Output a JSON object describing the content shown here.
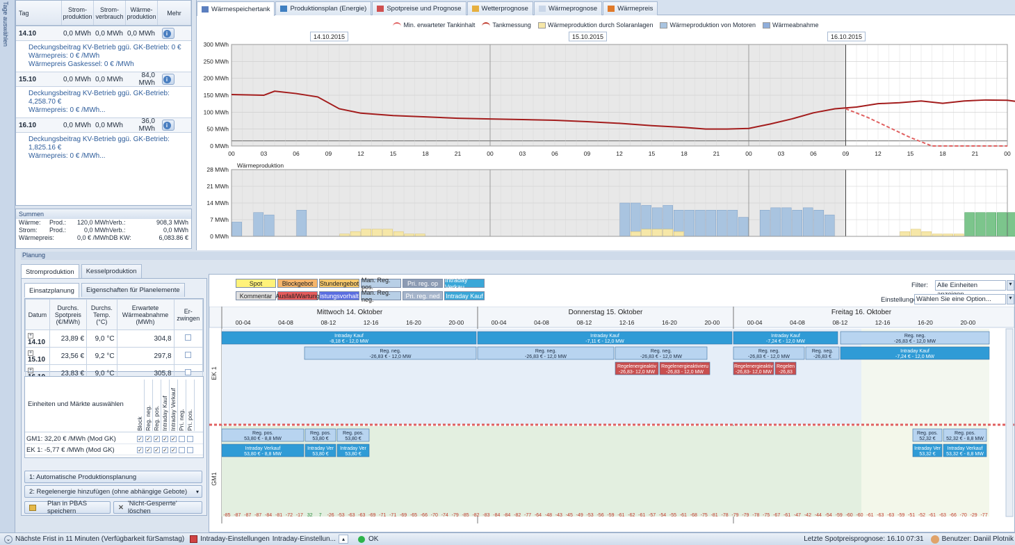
{
  "sidebar": {
    "vertical_label": "Tage auswählen"
  },
  "day_table": {
    "headers": [
      "Tag",
      "Strom-produktion",
      "Strom-verbrauch",
      "Wärme-produktion",
      "Mehr"
    ],
    "days": [
      {
        "date": "14.10",
        "strom_prod": "0,0 MWh",
        "strom_verb": "0,0 MWh",
        "waerme": "0,0 MWh",
        "lines": [
          "Deckungsbeitrag KV-Betrieb ggü. GK-Betrieb: 0 €",
          "Wärmepreis: 0 € /MWh",
          "Wärmepreis Gaskessel: 0 € /MWh"
        ]
      },
      {
        "date": "15.10",
        "strom_prod": "0,0 MWh",
        "strom_verb": "0,0 MWh",
        "waerme": "84,0 MWh",
        "lines": [
          "Deckungsbeitrag KV-Betrieb ggü. GK-Betrieb:",
          "4,258.70 €",
          "Wärmepreis: 0 € /MWh..."
        ]
      },
      {
        "date": "16.10",
        "strom_prod": "0,0 MWh",
        "strom_verb": "0,0 MWh",
        "waerme": "36,0 MWh",
        "lines": [
          "Deckungsbeitrag KV-Betrieb ggü. GK-Betrieb:",
          "1,825.16 €",
          "Wärmepreis: 0 € /MWh..."
        ]
      }
    ]
  },
  "summen": {
    "title": "Summen",
    "rows": [
      [
        "Wärme:",
        "Prod.:",
        "120,0 MWh",
        "Verb.:",
        "908,3 MWh"
      ],
      [
        "Strom:",
        "Prod.:",
        "0,0 MWh",
        "Verb.:",
        "0,0 MWh"
      ],
      [
        "Wärmepreis:",
        "",
        "0,0 € /MWh",
        "DB KW:",
        "6,083.86 €"
      ]
    ]
  },
  "chart_tabs": [
    "Wärmespeichertank",
    "Produktionsplan (Energie)",
    "Spotpreise und Prognose",
    "Wetterprognose",
    "Wärmeprognose",
    "Wärmepreis"
  ],
  "chart_legend": [
    {
      "label": "Min. erwarteter Tankinhalt",
      "color": "#e06060"
    },
    {
      "label": "Tankmessung",
      "color": "#c0392b"
    },
    {
      "label": "Wärmeproduktion durch Solaranlagen",
      "color": "#f6e7a8"
    },
    {
      "label": "Wärmeproduktion von Motoren",
      "color": "#a9c4e0"
    },
    {
      "label": "Wärmeabnahme",
      "color": "#8faedb"
    }
  ],
  "chart_dates": [
    "14.10.2015",
    "15.10.2015",
    "16.10.2015"
  ],
  "chart_data": [
    {
      "type": "line",
      "title": "",
      "ylabel": "",
      "xlabel": "",
      "ylim": [
        0,
        300
      ],
      "yticks": [
        "0 MWh",
        "50 MWh",
        "100 MWh",
        "150 MWh",
        "200 MWh",
        "250 MWh",
        "300 MWh"
      ],
      "xticks": [
        "00",
        "03",
        "06",
        "09",
        "12",
        "15",
        "18",
        "21",
        "00",
        "03",
        "06",
        "09",
        "12",
        "15",
        "18",
        "21",
        "00",
        "03",
        "06",
        "09",
        "12",
        "15",
        "18",
        "21",
        "00"
      ],
      "x_hours": [
        0,
        3,
        4,
        6,
        8,
        10,
        12,
        15,
        18,
        21,
        24,
        27,
        30,
        33,
        36,
        39,
        42,
        44,
        46,
        48,
        50,
        52,
        54,
        56,
        58,
        60,
        62,
        64,
        66,
        68,
        70,
        72,
        75,
        78,
        81,
        84,
        87,
        90
      ],
      "series": [
        {
          "name": "Tankmessung",
          "values": [
            152,
            150,
            162,
            155,
            145,
            110,
            97,
            90,
            86,
            82,
            80,
            78,
            76,
            72,
            67,
            60,
            55,
            50,
            50,
            52,
            65,
            80,
            98,
            110,
            115,
            125,
            128,
            133,
            126,
            133,
            136,
            135,
            123,
            110
          ],
          "x": [
            0,
            3,
            4,
            6,
            8,
            10,
            12,
            15,
            18,
            21,
            24,
            27,
            30,
            33,
            36,
            39,
            42,
            44,
            46,
            48,
            50,
            52,
            54,
            56,
            58,
            60,
            62,
            64,
            66,
            68,
            70,
            72,
            75,
            78
          ]
        },
        {
          "name": "Min. erwarteter Tankinhalt",
          "values": [
            110,
            85,
            55,
            25,
            0,
            0,
            0
          ],
          "x": [
            57,
            59,
            61,
            63,
            65,
            67,
            72
          ],
          "forecast": true
        }
      ],
      "forecast_start_hour": 57
    },
    {
      "type": "bar",
      "title": "Wärmeproduktion",
      "ylim": [
        0,
        28
      ],
      "yticks": [
        "0 MWh",
        "7 MWh",
        "14 MWh",
        "21 MWh",
        "28 MWh"
      ],
      "series": [
        {
          "name": "Wärmeproduktion von Motoren",
          "hours": [
            0,
            2,
            3,
            5,
            6,
            35,
            36,
            37,
            38,
            39,
            40,
            41,
            42,
            43,
            44,
            45,
            46,
            47,
            48,
            49,
            50,
            51,
            52,
            53,
            54,
            55,
            56,
            57
          ],
          "values": [
            6,
            10,
            9,
            0,
            11,
            0,
            14,
            14,
            13,
            12,
            13,
            11,
            11,
            11,
            11,
            11,
            11,
            8,
            0,
            11,
            12,
            12,
            11,
            12,
            11,
            9,
            0,
            0
          ]
        },
        {
          "name": "Wärmeproduktion durch Solaranlagen",
          "hours": [
            10,
            11,
            12,
            13,
            14,
            15,
            16,
            17,
            37,
            38,
            39,
            40,
            41,
            62,
            63,
            64,
            65,
            66,
            67
          ],
          "values": [
            1,
            2,
            3,
            3,
            3,
            2,
            1,
            1,
            2,
            3,
            3,
            3,
            2,
            2,
            3,
            2,
            1,
            1,
            1
          ]
        },
        {
          "name": "Wärmeabnahme",
          "hours": [
            68,
            69,
            70,
            71,
            72
          ],
          "values": [
            10,
            10,
            10,
            10,
            10
          ]
        }
      ]
    }
  ],
  "planung": {
    "title": "Planung",
    "tabs": [
      "Stromproduktion",
      "Kesselproduktion"
    ],
    "subtabs": [
      "Einsatzplanung",
      "Eigenschaften für Planelemente"
    ],
    "grid_headers": [
      "Datum",
      "Durchs. Spotpreis (€/MWh)",
      "Durchs. Temp. (°C)",
      "Erwartete Wärmeabnahme (MWh)",
      "Er-zwingen"
    ],
    "grid_rows": [
      [
        "14.10",
        "23,89 €",
        "9,0 °C",
        "304,8"
      ],
      [
        "15.10",
        "23,56 €",
        "9,2 °C",
        "297,8"
      ],
      [
        "16.10",
        "23,83 €",
        "9,0 °C",
        "305,8"
      ]
    ],
    "units_title": "Einheiten und Märkte auswählen",
    "units_cols": [
      "Block",
      "Reg. neg.",
      "Reg. pos.",
      "Intraday Kauf",
      "Intraday Verkauf",
      "Pri. neg.",
      "Pri. pos."
    ],
    "units": [
      {
        "label": "GM1: 32,20 € /MWh (Mod GK)",
        "checks": [
          true,
          true,
          true,
          true,
          true,
          false,
          false
        ]
      },
      {
        "label": "EK 1: -5,77 € /MWh (Mod GK)",
        "checks": [
          true,
          true,
          true,
          true,
          true,
          false,
          false
        ]
      }
    ],
    "buttons": [
      "1: Automatische Produktionsplanung",
      "2: Regelenergie hinzufügen (ohne abhängige Gebote)",
      "Plan in PBAS speichern",
      "'Nicht-Gesperrte' löschen"
    ],
    "legend_buttons": [
      {
        "label": "Spot",
        "bg": "#fff27a"
      },
      {
        "label": "Blockgebot",
        "bg": "#f6b56b"
      },
      {
        "label": "Stundengebot",
        "bg": "#f6c86b"
      },
      {
        "label": "Man. Reg. pos.",
        "bg": "#b8cfe6"
      },
      {
        "label": "Pri. reg. op",
        "bg": "#8c9bb3"
      },
      {
        "label": "Intraday Verkau",
        "bg": "#3aa7d8"
      },
      {
        "label": "Kommentar",
        "bg": "#e0e0e0"
      },
      {
        "label": "Ausfall/Wartung",
        "bg": "#e55b5b"
      },
      {
        "label": "istungsvorhalt",
        "bg": "#5b6ee1"
      },
      {
        "label": "Man. Reg. neg.",
        "bg": "#b8cfe6"
      },
      {
        "label": "Pri. reg. ned",
        "bg": "#a6b5cb"
      },
      {
        "label": "Intraday Kauf",
        "bg": "#3aa7d8"
      }
    ],
    "filter_label": "Filter:",
    "filter_value": "Alle Einheiten anzeigen",
    "settings_label": "Einstellungen:",
    "settings_value": "Wählen Sie eine Option...",
    "gantt_days": [
      "Mittwoch 14. Oktober",
      "Donnerstag 15. Oktober",
      "Freitag 16. Oktober"
    ],
    "gantt_slots": [
      "00-04",
      "04-08",
      "08-12",
      "12-16",
      "16-20",
      "20-00"
    ],
    "row_labels": [
      "EK 1",
      "GM1"
    ],
    "bars_ek1": [
      {
        "text": "Intraday Kauf",
        "sub": "-8,18 € - 12,0 MW",
        "x": 318,
        "w": 366,
        "row": 0,
        "bg": "#2f9bd6"
      },
      {
        "text": "Intraday Kauf",
        "sub": "-7,11 € - 12,0 MW",
        "x": 686,
        "w": 366,
        "row": 0,
        "bg": "#2f9bd6"
      },
      {
        "text": "Intraday Kauf",
        "sub": "-7,24 € - 12,0 MW",
        "x": 1054,
        "w": 150,
        "row": 0,
        "bg": "#2f9bd6"
      },
      {
        "text": "Reg. neg.",
        "sub": "-26,83 € - 12,0 MW",
        "x": 1208,
        "w": 214,
        "row": 0,
        "bg": "#b8d4f0",
        "dark": true
      },
      {
        "text": "Reg. neg.",
        "sub": "-26,83 € - 12,0 MW",
        "x": 437,
        "w": 247,
        "row": 1,
        "bg": "#b8d4f0",
        "dark": true
      },
      {
        "text": "Reg. neg.",
        "sub": "-26,83 € - 12,0 MW",
        "x": 686,
        "w": 196,
        "row": 1,
        "bg": "#b8d4f0",
        "dark": true
      },
      {
        "text": "Reg. neg.",
        "sub": "-26,83 € - 12,0 MW",
        "x": 884,
        "w": 132,
        "row": 1,
        "bg": "#b8d4f0",
        "dark": true
      },
      {
        "text": "Reg. neg.",
        "sub": "-26,83 € - 12,0 MW",
        "x": 1054,
        "w": 102,
        "row": 1,
        "bg": "#b8d4f0",
        "dark": true
      },
      {
        "text": "Reg. neg.",
        "sub": "-26,83 €",
        "x": 1158,
        "w": 48,
        "row": 1,
        "bg": "#b8d4f0",
        "dark": true
      },
      {
        "text": "Intraday Kauf",
        "sub": "-7,24 € - 12,0 MW",
        "x": 1208,
        "w": 214,
        "row": 1,
        "bg": "#2f9bd6"
      },
      {
        "text": "Regelenergieaktiv",
        "sub": "-26,83- 12,0 MW",
        "x": 884,
        "w": 62,
        "row": 2,
        "bg": "#c94f4f"
      },
      {
        "text": "Regelenergieaktivieru",
        "sub": "-26,83 - 12,0 MW",
        "x": 948,
        "w": 72,
        "row": 2,
        "bg": "#c94f4f"
      },
      {
        "text": "Regelenergieaktiv",
        "sub": "-26,83- 12,0 MW",
        "x": 1054,
        "w": 58,
        "row": 2,
        "bg": "#c94f4f"
      },
      {
        "text": "Regelen",
        "sub": "-26,83",
        "x": 1114,
        "w": 30,
        "row": 2,
        "bg": "#c94f4f"
      }
    ],
    "bars_gm1": [
      {
        "text": "Reg. pos.",
        "sub": "53,80 € - 8,8 MW",
        "x": 318,
        "w": 118,
        "row": 0,
        "bg": "#b8d4f0",
        "dark": true
      },
      {
        "text": "Reg. pos.",
        "sub": "53,80 €",
        "x": 438,
        "w": 44,
        "row": 0,
        "bg": "#b8d4f0",
        "dark": true
      },
      {
        "text": "Reg. pos.",
        "sub": "53,80 €",
        "x": 484,
        "w": 46,
        "row": 0,
        "bg": "#b8d4f0",
        "dark": true
      },
      {
        "text": "Intraday Verkauf",
        "sub": "53,80 € - 8,8 MW",
        "x": 318,
        "w": 118,
        "row": 1,
        "bg": "#2f9bd6"
      },
      {
        "text": "Intraday Ver",
        "sub": "53,80 €",
        "x": 438,
        "w": 44,
        "row": 1,
        "bg": "#2f9bd6"
      },
      {
        "text": "Intraday Ver",
        "sub": "53,80 €",
        "x": 484,
        "w": 46,
        "row": 1,
        "bg": "#2f9bd6"
      },
      {
        "text": "Reg. pos.",
        "sub": "52,32 €",
        "x": 1312,
        "w": 42,
        "row": 0,
        "bg": "#b8d4f0",
        "dark": true
      },
      {
        "text": "Reg. pos.",
        "sub": "52,32 € - 8,8 MW",
        "x": 1356,
        "w": 62,
        "row": 0,
        "bg": "#b8d4f0",
        "dark": true
      },
      {
        "text": "Intraday Ver",
        "sub": "53,32 €",
        "x": 1312,
        "w": 42,
        "row": 1,
        "bg": "#2f9bd6"
      },
      {
        "text": "Intraday Verkauf",
        "sub": "53,32 € - 8,8 MW",
        "x": 1356,
        "w": 62,
        "row": 1,
        "bg": "#2f9bd6"
      }
    ],
    "price_row": [
      "-85",
      "-87",
      "-87",
      "-87",
      "-84",
      "-81",
      "-72",
      "-17",
      "32",
      "7",
      "-26",
      "-53",
      "-63",
      "-63",
      "-69",
      "-71",
      "-71",
      "-69",
      "-65",
      "-66",
      "-70",
      "-74",
      "-79",
      "-85",
      "-82",
      "-83",
      "-84",
      "-84",
      "-82",
      "-77",
      "-64",
      "-48",
      "-43",
      "-45",
      "-49",
      "-53",
      "-56",
      "-59",
      "-61",
      "-62",
      "-61",
      "-57",
      "-54",
      "-55",
      "-61",
      "-68",
      "-75",
      "-81",
      "-78",
      "-79",
      "-79",
      "-78",
      "-75",
      "-67",
      "-61",
      "-47",
      "-42",
      "-44",
      "-54",
      "-59",
      "-60",
      "-60",
      "-61",
      "-63",
      "-63",
      "-59",
      "-51",
      "-52",
      "-61",
      "-63",
      "-66",
      "-70",
      "-29",
      "-77"
    ]
  },
  "statusbar": {
    "deadline": "Nächste Frist in 11 Minuten (Verfügbarkeit fürSamstag)",
    "settings_label": "Intraday-Einstellungen",
    "settings_value": "Intraday-Einstellun...",
    "status": "OK",
    "last_forecast": "Letzte Spotpreisprognose: 16.10 07:31",
    "user": "Benutzer: Daniil Plotnik"
  }
}
